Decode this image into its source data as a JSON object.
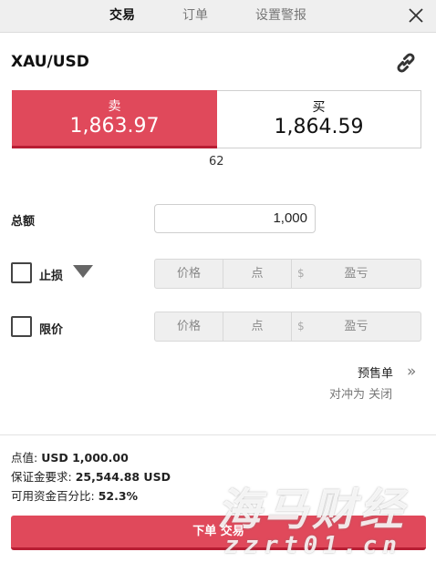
{
  "tabs": [
    {
      "label": "交易",
      "active": true
    },
    {
      "label": "订单",
      "active": false
    },
    {
      "label": "设置警报",
      "active": false
    }
  ],
  "symbol": "XAU/USD",
  "quote": {
    "sell_label": "卖",
    "sell_price": "1,863.97",
    "buy_label": "买",
    "buy_price": "1,864.59",
    "spread": "62"
  },
  "amount": {
    "label": "总额",
    "value": "1,000"
  },
  "stop_loss": {
    "label": "止损",
    "price_placeholder": "价格",
    "points_placeholder": "点",
    "currency_symbol": "$",
    "pnl_placeholder": "盈亏"
  },
  "limit": {
    "label": "限价",
    "price_placeholder": "价格",
    "points_placeholder": "点",
    "currency_symbol": "$",
    "pnl_placeholder": "盈亏"
  },
  "pre_order": "预售单",
  "hedging_status": "对冲为 关闭",
  "info": {
    "pip_value_label": "点值:",
    "pip_value": "USD 1,000.00",
    "margin_label": "保证金要求:",
    "margin": "25,544.88 USD",
    "available_label": "可用资金百分比:",
    "available": "52.3%"
  },
  "order_button": "下单 交易",
  "watermark": {
    "text": "海马财经",
    "url": "zzrt01.cn"
  },
  "colors": {
    "sell": "#e0495b",
    "sell_border": "#b81d33",
    "tab_bar": "#efefef"
  }
}
